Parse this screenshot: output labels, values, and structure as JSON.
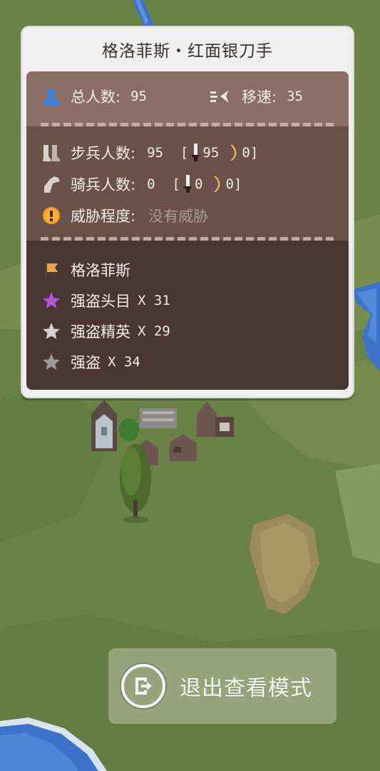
{
  "party": {
    "title": "格洛菲斯・红面银刀手",
    "total_label": "总人数:",
    "total_value": "95",
    "speed_label": "移速:",
    "speed_value": "35"
  },
  "composition": {
    "infantry_label": "步兵人数:",
    "infantry_value": "95",
    "infantry_open": "[",
    "infantry_melee": "95",
    "infantry_ranged": "0]",
    "cavalry_label": "骑兵人数:",
    "cavalry_value": "0",
    "cavalry_open": "[",
    "cavalry_melee": "0",
    "cavalry_ranged": "0]",
    "threat_label": "威胁程度:",
    "threat_value": "没有威胁"
  },
  "troops": [
    {
      "name": "格洛菲斯",
      "count": "",
      "icon": "banner-icon",
      "color": "#e8a64c"
    },
    {
      "name": "强盗头目",
      "count": "X 31",
      "icon": "star-icon",
      "color": "#b455d9"
    },
    {
      "name": "强盗精英",
      "count": "X 29",
      "icon": "star-icon",
      "color": "#d0d0d0"
    },
    {
      "name": "强盗",
      "count": "X 34",
      "icon": "star-icon",
      "color": "#9a9a9a"
    }
  ],
  "exit": {
    "label": "退出查看模式",
    "icon": "exit-icon"
  }
}
